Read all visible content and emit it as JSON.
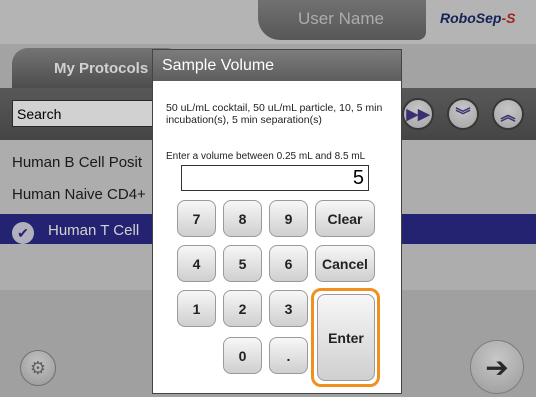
{
  "topbar": {
    "user_name": "User Name",
    "logo_main": "RoboSep",
    "logo_suffix": "-S"
  },
  "panel": {
    "tab_label": "My Protocols",
    "search_placeholder": "Search",
    "controls": [
      {
        "icon": "fast-forward-icon",
        "glyph": "▶▶"
      },
      {
        "icon": "double-chevron-down-icon",
        "glyph": "⏬"
      },
      {
        "icon": "double-chevron-up-icon",
        "glyph": "⏫"
      }
    ]
  },
  "protocols": [
    {
      "label": "Human B Cell Posit",
      "selected": false
    },
    {
      "label": "Human Naive CD4+",
      "selected": false
    },
    {
      "label": "Human T Cell",
      "selected": true
    }
  ],
  "dialog": {
    "title": "Sample Volume",
    "description": "50 uL/mL cocktail, 50 uL/mL particle, 10, 5 min incubation(s), 5 min separation(s)",
    "prompt": "Enter a volume between 0.25 mL and 8.5 mL",
    "value": "5",
    "keys": {
      "k7": "7",
      "k8": "8",
      "k9": "9",
      "k4": "4",
      "k5": "5",
      "k6": "6",
      "k1": "1",
      "k2": "2",
      "k3": "3",
      "k0": "0",
      "dot": ".",
      "clear": "Clear",
      "cancel": "Cancel",
      "enter": "Enter"
    }
  },
  "colors": {
    "selected_row": "#2b2b8c",
    "enter_highlight": "#f0901e",
    "header": "#6a6a6a"
  }
}
